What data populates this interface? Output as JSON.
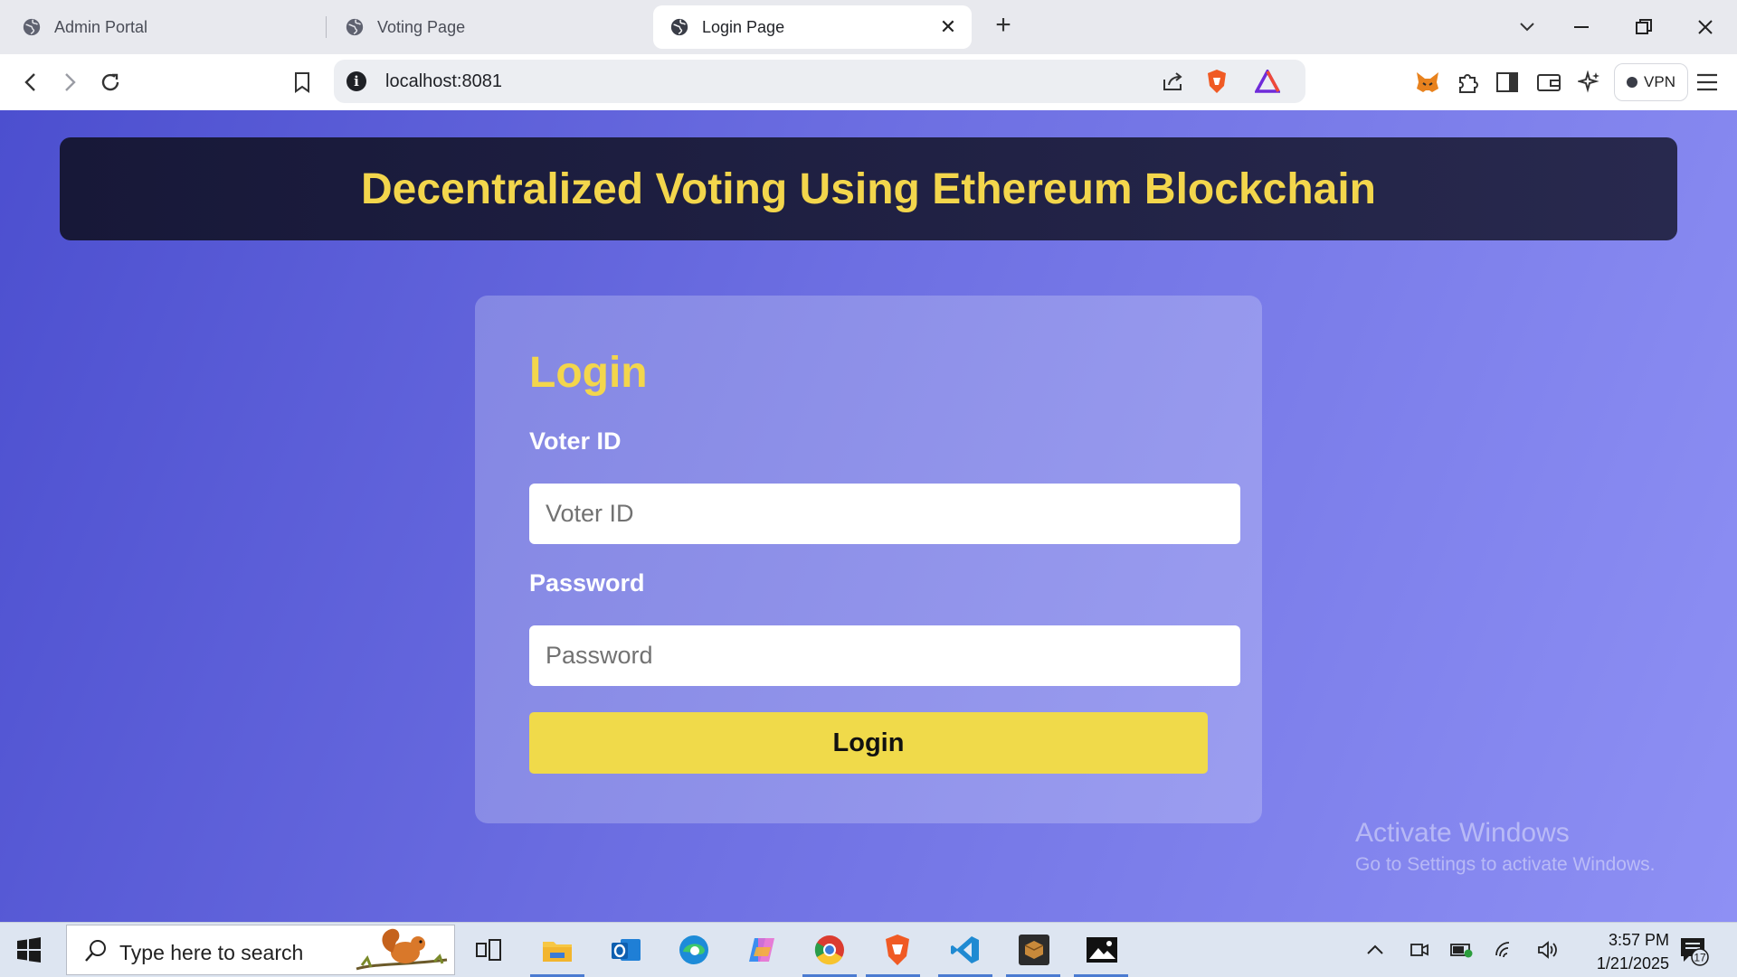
{
  "browser": {
    "tabs": [
      {
        "label": "Admin Portal",
        "active": false
      },
      {
        "label": "Voting Page",
        "active": false
      },
      {
        "label": "Login Page",
        "active": true
      }
    ],
    "url": "localhost:8081",
    "vpn_label": "VPN"
  },
  "page": {
    "banner_title": "Decentralized Voting Using Ethereum Blockchain",
    "login": {
      "heading": "Login",
      "voter_id_label": "Voter ID",
      "voter_id_placeholder": "Voter ID",
      "voter_id_value": "",
      "password_label": "Password",
      "password_placeholder": "Password",
      "password_value": "",
      "button_label": "Login"
    },
    "watermark": {
      "line1": "Activate Windows",
      "line2": "Go to Settings to activate Windows."
    }
  },
  "taskbar": {
    "search_placeholder": "Type here to search",
    "time": "3:57 PM",
    "date": "1/21/2025",
    "notification_count": "17",
    "apps": [
      "task-view",
      "file-explorer",
      "outlook",
      "edge",
      "copilot",
      "chrome",
      "brave",
      "vscode",
      "virtualbox",
      "photos"
    ]
  },
  "colors": {
    "accent_yellow": "#f3d64c",
    "button_yellow": "#f0da4a",
    "banner_dark": "#171838",
    "page_gradient_start": "#4c4fcf",
    "page_gradient_end": "#8e90f4"
  }
}
